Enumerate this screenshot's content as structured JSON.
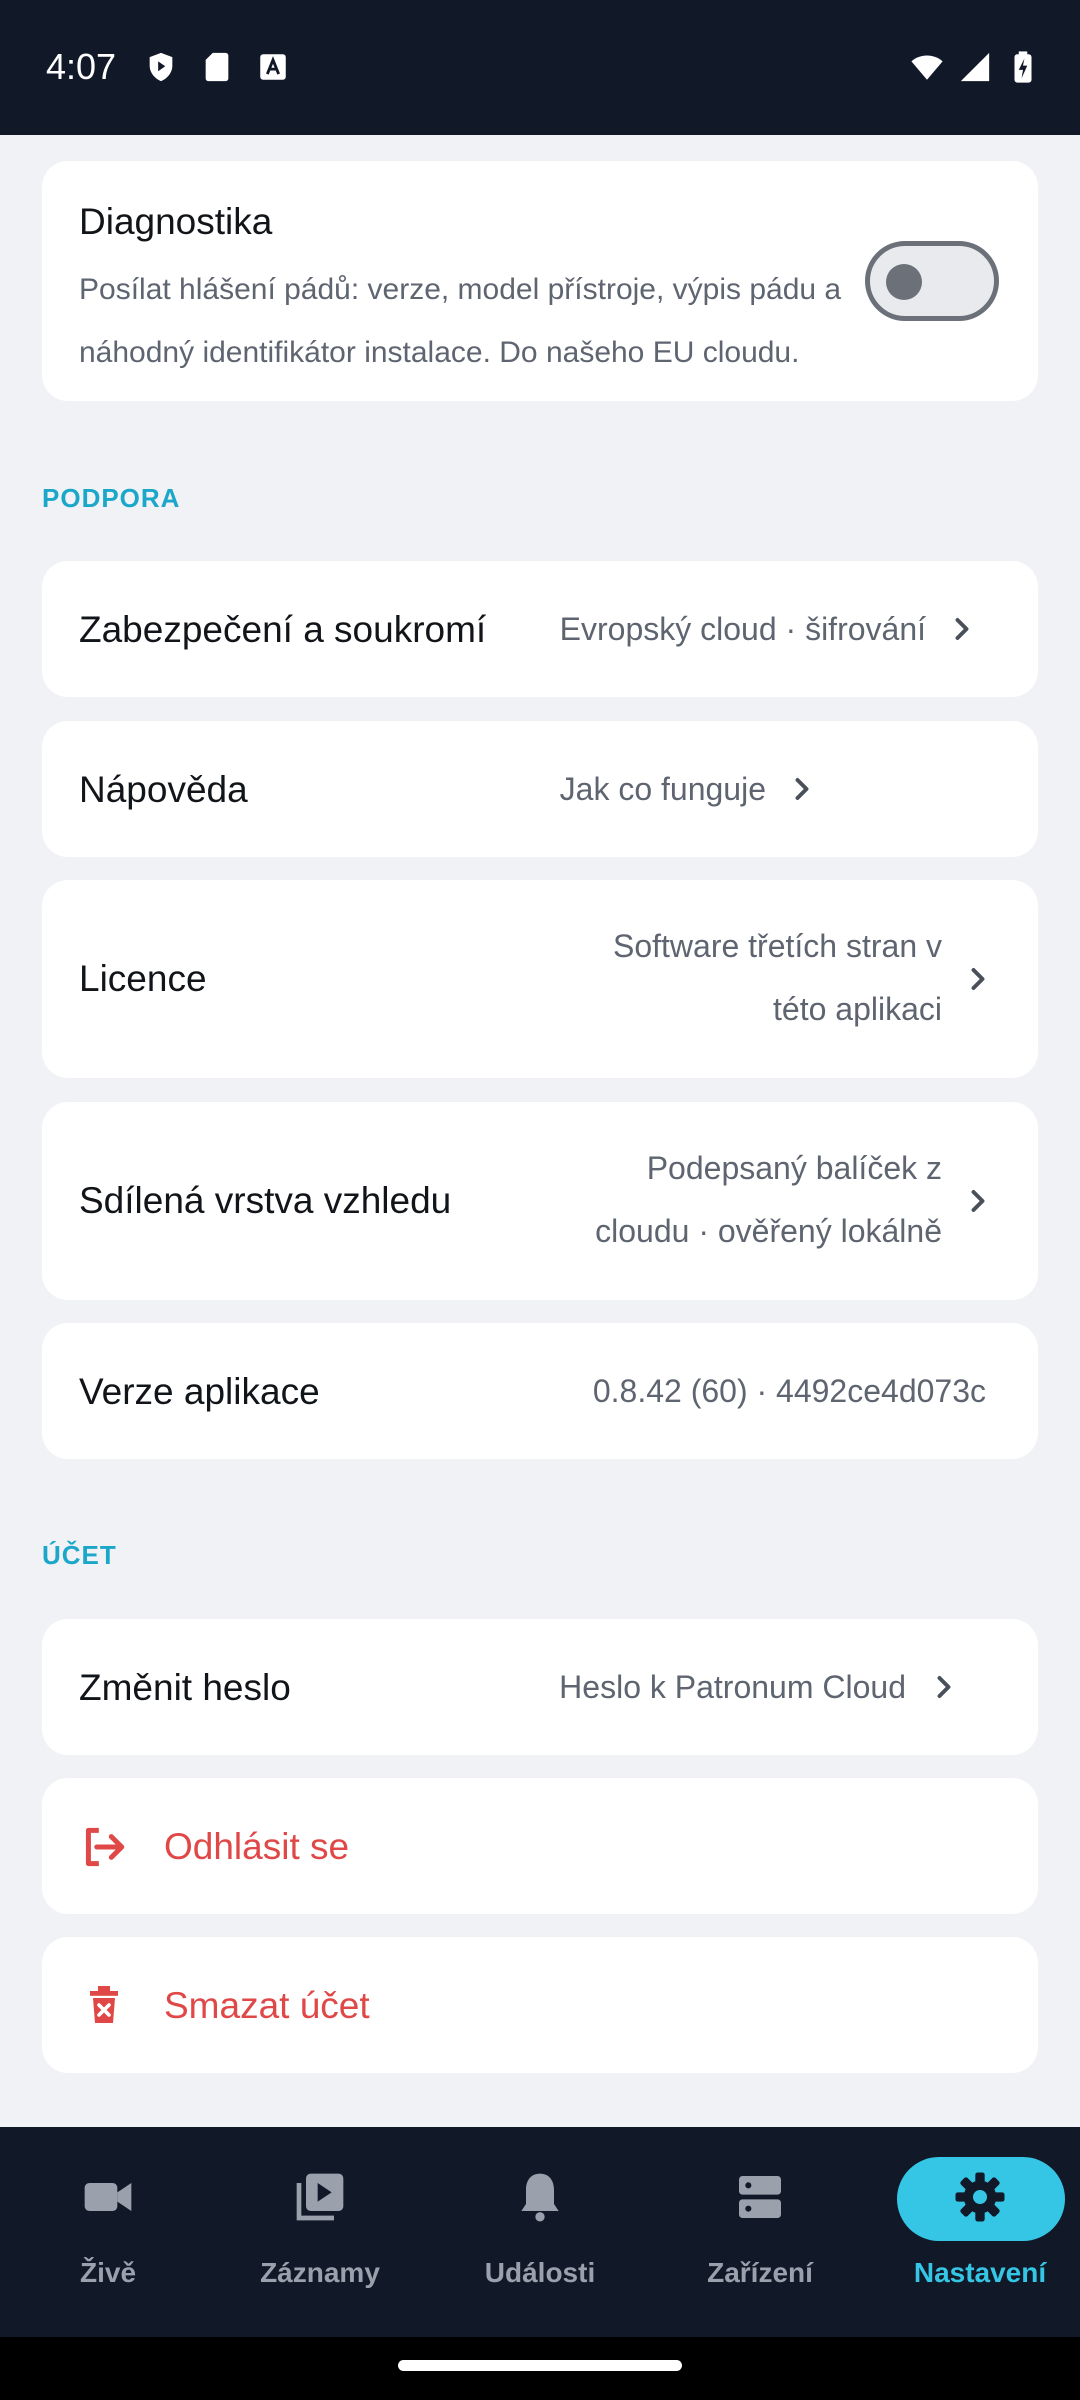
{
  "status_bar": {
    "time": "4:07"
  },
  "diagnostics": {
    "title": "Diagnostika",
    "description": "Posílat hlášení pádů: verze, model přístroje, výpis pádu a náhodný identifikátor instalace. Do našeho EU cloudu.",
    "toggle_on": false
  },
  "sections": {
    "support": "PODPORA",
    "account": "ÚČET"
  },
  "rows": {
    "security": {
      "title": "Zabezpečení a soukromí",
      "value": "Evropský cloud · šifrování"
    },
    "help": {
      "title": "Nápověda",
      "value": "Jak co funguje"
    },
    "licence": {
      "title": "Licence",
      "value_line1": "Software třetích stran v",
      "value_line2": "této aplikaci"
    },
    "skin": {
      "title": "Sdílená vrstva vzhledu",
      "value_line1": "Podepsaný balíček z",
      "value_line2": "cloudu · ověřený lokálně"
    },
    "version": {
      "title": "Verze aplikace",
      "value": "0.8.42 (60) · 4492ce4d073c"
    },
    "password": {
      "title": "Změnit heslo",
      "value": "Heslo k Patronum Cloud"
    },
    "logout": {
      "title": "Odhlásit se"
    },
    "delete": {
      "title": "Smazat účet"
    }
  },
  "nav": {
    "live": "Živě",
    "recordings": "Záznamy",
    "events": "Události",
    "devices": "Zařízení",
    "settings": "Nastavení",
    "active": "settings"
  },
  "colors": {
    "accent": "#35c6e6",
    "section_label": "#1aa7c9",
    "danger": "#e04848",
    "dark_bar": "#111827"
  }
}
